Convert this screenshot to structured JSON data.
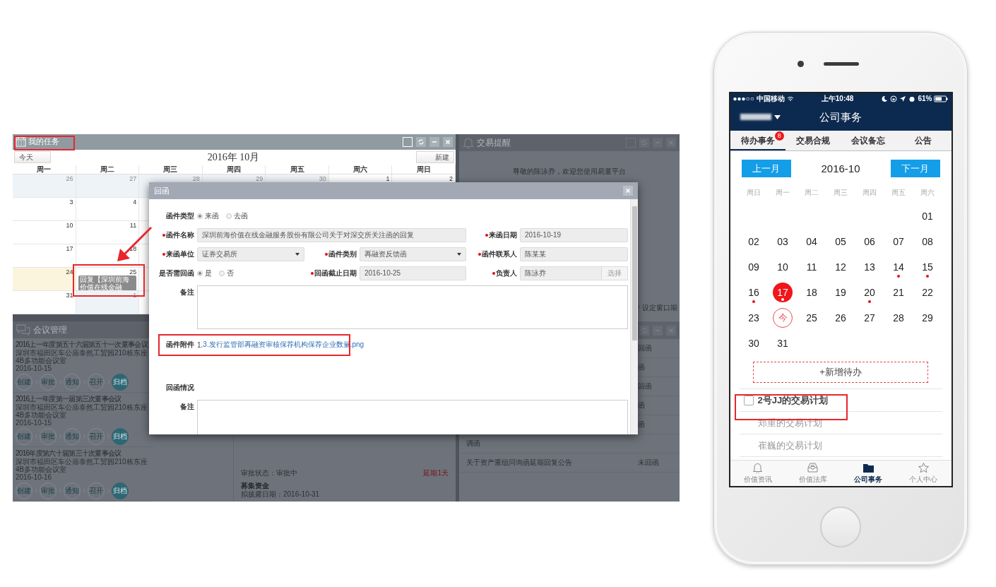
{
  "desktop": {
    "tasks_panel": {
      "title": "我的任务",
      "today_button": "今天",
      "month_title": "2016年 10月",
      "new_button": "新建",
      "weekdays": [
        "周一",
        "周二",
        "周三",
        "周四",
        "周五",
        "周六",
        "周日"
      ],
      "weeks": [
        [
          {
            "day": "26",
            "other_month": true,
            "highlighted": false
          },
          {
            "day": "27",
            "other_month": true,
            "highlighted": false
          },
          {
            "day": "28",
            "other_month": true,
            "highlighted": false
          },
          {
            "day": "29",
            "other_month": true,
            "highlighted": false
          },
          {
            "day": "30",
            "other_month": true,
            "highlighted": false
          },
          {
            "day": "1",
            "other_month": false,
            "highlighted": false
          },
          {
            "day": "2",
            "other_month": false,
            "highlighted": false
          }
        ],
        [
          {
            "day": "3",
            "other_month": false,
            "highlighted": false
          },
          {
            "day": "4",
            "other_month": false,
            "highlighted": false
          }
        ],
        [
          {
            "day": "10",
            "other_month": false,
            "highlighted": false
          },
          {
            "day": "11",
            "other_month": false,
            "highlighted": false
          }
        ],
        [
          {
            "day": "17",
            "other_month": false,
            "highlighted": false
          },
          {
            "day": "18",
            "other_month": false,
            "highlighted": false
          }
        ],
        [
          {
            "day": "24",
            "other_month": false,
            "highlighted": true
          },
          {
            "day": "25",
            "other_month": false,
            "highlighted": false,
            "events": [
              "回复【深圳前海价值在线金融"
            ]
          }
        ],
        [
          {
            "day": "31",
            "other_month": false,
            "highlighted": false
          },
          {
            "day": "1",
            "other_month": true,
            "highlighted": false
          }
        ]
      ]
    },
    "meetings_panel": {
      "title": "会议管理",
      "meetings": [
        {
          "title": "2016上一年度第五十六届第五十一次董事会议",
          "location": "深圳市福田区车公庙泰然工贸园210栋东座4B多功能会议室",
          "date": "2016-10-15",
          "steps": [
            {
              "label": "创建",
              "current": false
            },
            {
              "label": "审批",
              "current": false
            },
            {
              "label": "通知",
              "current": false
            },
            {
              "label": "召开",
              "current": false
            },
            {
              "label": "归档",
              "current": true
            }
          ]
        },
        {
          "title": "2016上一年度第一届第三次董事会议",
          "location": "深圳市福田区车公庙泰然工贸园210栋东座4B多功能会议室",
          "date": "2016-10-15",
          "steps": [
            {
              "label": "创建",
              "current": false
            },
            {
              "label": "审批",
              "current": false
            },
            {
              "label": "通知",
              "current": false
            },
            {
              "label": "召开",
              "current": false
            },
            {
              "label": "归档",
              "current": true
            }
          ]
        },
        {
          "title": "2016年度第六十届第三十次董事会议",
          "location": "深圳市福田区车公庙泰然工贸园210栋东座4B多功能会议室",
          "date": "2016-10-16",
          "steps": [
            {
              "label": "创建",
              "current": false
            },
            {
              "label": "审批",
              "current": false
            },
            {
              "label": "通知",
              "current": false
            },
            {
              "label": "召开",
              "current": false
            },
            {
              "label": "归档",
              "current": true
            }
          ]
        }
      ]
    },
    "approvals_panel": {
      "status": "审批状态：审批中",
      "delay": "延期1天",
      "next_title": "募集资金",
      "next_date": "拟披露日期：2016-10-31"
    },
    "alerts_panel": {
      "title": "交易提醒",
      "welcome": "尊敬的陈泳乔，欢迎您使用易董平台",
      "window_link": "设定窗口期"
    },
    "letters_panel": {
      "rows": [
        {
          "status": "回函"
        },
        {
          "status": "函"
        },
        {
          "status": "回函"
        },
        {
          "status": "函"
        },
        {
          "status": "函"
        },
        {
          "title": "调函"
        },
        {
          "title": "关于资产重组问询函延期回复公告",
          "status": "未回函"
        }
      ]
    },
    "dialog": {
      "title": "回函",
      "letter_type": {
        "label": "函件类型",
        "required": false,
        "options": [
          {
            "label": "来函",
            "selected": true
          },
          {
            "label": "去函",
            "selected": false
          }
        ]
      },
      "letter_name": {
        "label": "函件名称",
        "required": true,
        "value": "深圳前海价值在线金融服务股份有限公司关于对深交所关注函的回复"
      },
      "received_date": {
        "label": "来函日期",
        "required": true,
        "value": "2016-10-19"
      },
      "sender": {
        "label": "来函单位",
        "required": true,
        "value": "证券交易所"
      },
      "category": {
        "label": "函件类别",
        "required": true,
        "value": "再融资反馈函"
      },
      "contact": {
        "label": "函件联系人",
        "required": true,
        "value": "陈某某"
      },
      "needs_reply": {
        "label": "是否需回函",
        "required": false,
        "options": [
          {
            "label": "是",
            "selected": true
          },
          {
            "label": "否",
            "selected": false
          }
        ]
      },
      "deadline": {
        "label": "回函截止日期",
        "required": true,
        "value": "2016-10-25"
      },
      "owner": {
        "label": "负责人",
        "required": true,
        "value": "陈泳乔",
        "button": "选择"
      },
      "remarks": {
        "label": "备注"
      },
      "attachment": {
        "label": "函件附件",
        "prefix": "1.",
        "link": "3.发行监管部再融资审核保荐机构保荐企业数量.png"
      },
      "reply_section": "回函情况",
      "reply_remarks": {
        "label": "备注"
      }
    }
  },
  "phone": {
    "status_bar": {
      "signal": "●●●○○",
      "carrier": "中国移动",
      "time": "上午10:48",
      "battery": "61%"
    },
    "title": "公司事务",
    "tabs": [
      {
        "label": "待办事务",
        "selected": true,
        "badge": "8"
      },
      {
        "label": "交易合规",
        "selected": false
      },
      {
        "label": "会议备忘",
        "selected": false
      },
      {
        "label": "公告",
        "selected": false
      }
    ],
    "prev_button": "上一月",
    "month": "2016-10",
    "next_button": "下一月",
    "weekdays": [
      "周日",
      "周一",
      "周二",
      "周三",
      "周四",
      "周五",
      "周六"
    ],
    "weeks": [
      [
        {
          "day": "01",
          "dot": false,
          "selected": false,
          "today": false
        }
      ],
      [
        {
          "day": "02",
          "dot": false,
          "selected": false,
          "today": false
        },
        {
          "day": "03",
          "dot": false,
          "selected": false,
          "today": false
        },
        {
          "day": "04",
          "dot": false,
          "selected": false,
          "today": false
        },
        {
          "day": "05",
          "dot": false,
          "selected": false,
          "today": false
        },
        {
          "day": "06",
          "dot": false,
          "selected": false,
          "today": false
        },
        {
          "day": "07",
          "dot": false,
          "selected": false,
          "today": false
        },
        {
          "day": "08",
          "dot": false,
          "selected": false,
          "today": false
        }
      ],
      [
        {
          "day": "09",
          "dot": false,
          "selected": false,
          "today": false
        },
        {
          "day": "10",
          "dot": false,
          "selected": false,
          "today": false
        },
        {
          "day": "11",
          "dot": false,
          "selected": false,
          "today": false
        },
        {
          "day": "12",
          "dot": false,
          "selected": false,
          "today": false
        },
        {
          "day": "13",
          "dot": false,
          "selected": false,
          "today": false
        },
        {
          "day": "14",
          "dot": true,
          "selected": false,
          "today": false
        },
        {
          "day": "15",
          "dot": true,
          "selected": false,
          "today": false
        }
      ],
      [
        {
          "day": "16",
          "dot": true,
          "selected": false,
          "today": false
        },
        {
          "day": "17",
          "dot": true,
          "selected": true,
          "today": false
        },
        {
          "day": "18",
          "dot": false,
          "selected": false,
          "today": false
        },
        {
          "day": "19",
          "dot": false,
          "selected": false,
          "today": false
        },
        {
          "day": "20",
          "dot": true,
          "selected": false,
          "today": false
        },
        {
          "day": "21",
          "dot": false,
          "selected": false,
          "today": false
        },
        {
          "day": "22",
          "dot": false,
          "selected": false,
          "today": false
        }
      ],
      [
        {
          "day": "23",
          "dot": false,
          "selected": false,
          "today": false
        },
        {
          "day": "今",
          "dot": false,
          "selected": false,
          "today": true
        },
        {
          "day": "25",
          "dot": false,
          "selected": false,
          "today": false
        },
        {
          "day": "26",
          "dot": false,
          "selected": false,
          "today": false
        },
        {
          "day": "27",
          "dot": false,
          "selected": false,
          "today": false
        },
        {
          "day": "28",
          "dot": false,
          "selected": false,
          "today": false
        },
        {
          "day": "29",
          "dot": false,
          "selected": false,
          "today": false
        }
      ],
      [
        {
          "day": "30",
          "dot": false,
          "selected": false,
          "today": false
        },
        {
          "day": "31",
          "dot": false,
          "selected": false,
          "today": false
        }
      ]
    ],
    "add_button": "+新增待办",
    "todos": [
      {
        "kind": "checkbox",
        "label": "2号JJ的交易计划",
        "checked": false
      },
      {
        "kind": "plain",
        "label": "郑重的交易计划"
      },
      {
        "kind": "plain",
        "label": "崔巍的交易计划"
      }
    ],
    "tab_bar": [
      {
        "label": "价值资讯",
        "selected": false
      },
      {
        "label": "价值法库",
        "selected": false
      },
      {
        "label": "公司事务",
        "selected": true
      },
      {
        "label": "个人中心",
        "selected": false
      }
    ]
  }
}
